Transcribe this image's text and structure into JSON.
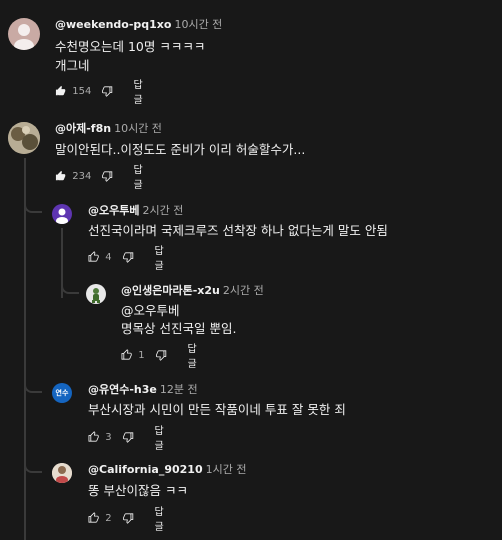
{
  "comments": [
    {
      "author": "@weekendo-pq1xo",
      "time": "10시간 전",
      "lines": [
        "수천명오는데 10명 ㅋㅋㅋㅋ",
        "개그네"
      ],
      "likes": "154",
      "reply_label": "답글"
    },
    {
      "author": "@아제-f8n",
      "time": "10시간 전",
      "lines": [
        "말이안된다..이정도도 준비가 이리 허술할수가..."
      ],
      "likes": "234",
      "reply_label": "답글"
    },
    {
      "author": "@오우투베",
      "time": "2시간 전",
      "lines": [
        "선진국이라며 국제크루즈 선착장 하나 없다는게 말도 안됨"
      ],
      "likes": "4",
      "reply_label": "답글"
    },
    {
      "author": "@인생은마라톤-x2u",
      "time": "2시간 전",
      "lines": [
        "@오우투베",
        "명목상 선진국일 뿐임."
      ],
      "likes": "1",
      "reply_label": "답글"
    },
    {
      "author": "@유연수-h3e",
      "time": "12분 전",
      "avatar_text": "연수",
      "lines": [
        "부산시장과 시민이 만든 작품이네 투표 잘 못한 죄"
      ],
      "likes": "3",
      "reply_label": "답글"
    },
    {
      "author": "@California_90210",
      "time": "1시간 전",
      "lines": [
        "똥 부산이잖음 ㅋㅋ"
      ],
      "likes": "2",
      "reply_label": "답글"
    }
  ],
  "colors": {
    "background": "#181818",
    "text": "#f1f1f1",
    "secondary": "#aaaaaa",
    "thread_line": "#3a3a3a",
    "avatar_purple": "#5e35b1",
    "avatar_blue": "#1565c0"
  }
}
